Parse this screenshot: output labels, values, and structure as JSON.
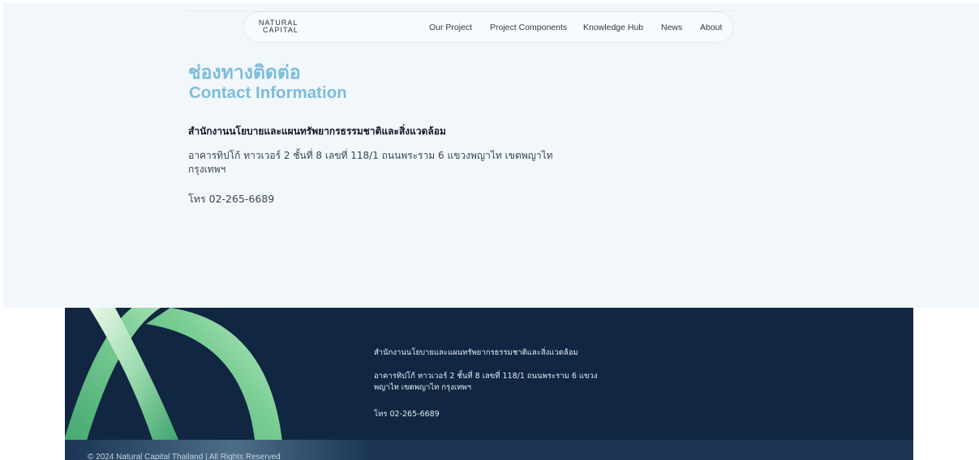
{
  "brand": {
    "logo_line1": "NATURAL",
    "logo_line2": "CAPITAL"
  },
  "nav": {
    "items": [
      "Our Project",
      "Project Components",
      "Knowledge Hub",
      "News",
      "About"
    ]
  },
  "contact": {
    "title_th": "ช่องทางติดต่อ",
    "title_en": "Contact Information",
    "org_name": "สำนักงานนโยบายและแผนทรัพยากรธรรมชาติและสิ่งแวดล้อม",
    "address": "อาคารทิปโก้ ทาวเวอร์ 2 ชั้นที่ 8 เลขที่ 118/1 ถนนพระราม 6 แขวงพญาไท เขตพญาไท กรุงเทพฯ",
    "phone": "โทร 02-265-6689"
  },
  "footer": {
    "org_name": "สำนักงานนโยบายและแผนทรัพยากรธรรมชาติและสิ่งแวดล้อม",
    "address": "อาคารทิปโก้ ทาวเวอร์ 2 ชั้นที่ 8 เลขที่ 118/1 ถนนพระราม 6 แขวงพญาไท เขตพญาไท กรุงเทพฯ",
    "phone": "โทร 02-265-6689",
    "copyright": "© 2024 Natural Capital Thailand | All Rights Reserved"
  },
  "colors": {
    "accent": "#7cbcdc",
    "footer_bg": "#102641",
    "page_bg": "#f2f7fc"
  }
}
